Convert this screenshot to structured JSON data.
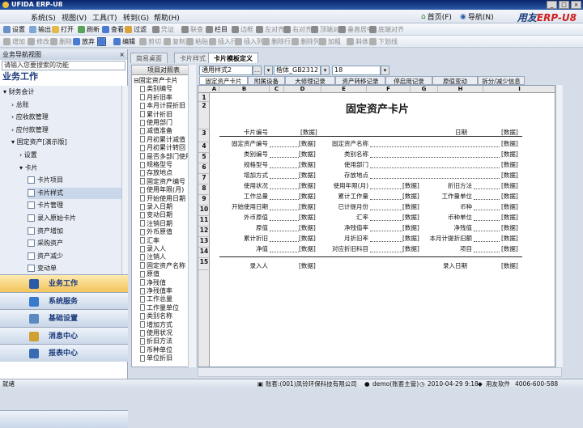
{
  "window": {
    "title": "UFIDA ERP-U8",
    "controls": [
      "_",
      "□",
      "×"
    ]
  },
  "menu": {
    "items": [
      "系统(S)",
      "视图(V)",
      "工具(T)",
      "转到(G)",
      "帮助(H)"
    ],
    "right": [
      "首页(F)",
      "导航(N)"
    ],
    "brand_a": "用友",
    "brand_b": "ERP-U8"
  },
  "toolbar1": [
    "设置",
    "输出",
    "打开",
    "刷新",
    "查看",
    "过滤",
    "凭证",
    "联查",
    "栏目",
    "边框",
    "左对齐",
    "右对齐",
    "顶端对齐",
    "垂直居中",
    "底端对齐"
  ],
  "toolbar2": [
    "增加",
    "修改",
    "删除",
    "放弃",
    "保存",
    "编辑",
    "剪切",
    "复制",
    "粘贴",
    "插入行",
    "插入列",
    "删除行",
    "删除列",
    "加粗",
    "斜体",
    "下划线"
  ],
  "sidebar": {
    "header": "业务导航视图",
    "search_placeholder": "请输入您要搜索的功能",
    "title": "业务工作",
    "tree": [
      "财务会计",
      "总账",
      "应收款管理",
      "应付款管理",
      "固定资产[演示版]",
      "设置",
      "卡片",
      "卡片项目",
      "卡片样式",
      "卡片管理",
      "录入原始卡片",
      "资产增加",
      "采购资产",
      "资产减少",
      "变动单"
    ],
    "modules": [
      "业务工作",
      "系统服务",
      "基础设置",
      "消息中心",
      "报表中心"
    ]
  },
  "tabs": [
    "简易桌面",
    "卡片样式",
    "卡片模板定义"
  ],
  "lefttree": {
    "header": "项目对照表",
    "items": [
      "固定资产卡片",
      "类别编号",
      "月折旧率",
      "本月计提折旧",
      "累计折旧",
      "使用部门",
      "减值准备",
      "月初累计减值",
      "月初累计转回",
      "是否多部门使用",
      "规格型号",
      "存放地点",
      "固定资产编号",
      "使用年限(月)",
      "开始使用日期",
      "录入日期",
      "变动日期",
      "注销日期",
      "外币原值",
      "汇率",
      "录入人",
      "注销人",
      "固定资产名称",
      "原值",
      "净残值",
      "净残值率",
      "工作总量",
      "工作量单位",
      "类别名称",
      "增加方式",
      "使用状况",
      "折旧方法",
      "币种单位",
      "单位折旧"
    ]
  },
  "format": {
    "style": "通用样式2",
    "font": "楷体_GB2312",
    "size": "18"
  },
  "subtabs": [
    "固定资产卡片",
    "附属设备",
    "大修理记录",
    "资产转移记录",
    "停启用记录",
    "原值变动",
    "拆分/减少信息"
  ],
  "grid": {
    "columns": [
      "A",
      "B",
      "C",
      "D",
      "E",
      "F",
      "G",
      "H",
      "I"
    ],
    "rows": [
      "1",
      "2",
      "3",
      "4",
      "5",
      "6",
      "7",
      "8",
      "9",
      "10",
      "11",
      "12",
      "13",
      "14",
      "15"
    ],
    "title": "固定资产卡片",
    "placeholder": "[数据]",
    "row3": {
      "a": "卡片编号",
      "b": "日期"
    },
    "pairs": [
      [
        "固定资产编号",
        "固定资产名称"
      ],
      [
        "类别编号",
        "类别名称"
      ],
      [
        "规格型号",
        "使用部门"
      ],
      [
        "增加方式",
        "存放地点"
      ]
    ],
    "triples": [
      [
        "使用状况",
        "使用年限(月)",
        "折旧方法"
      ],
      [
        "工作总量",
        "累计工作量",
        "工作量单位"
      ],
      [
        "开始使用日期",
        "已计提月份",
        "币种"
      ],
      [
        "外币原值",
        "汇率",
        "币种单位"
      ],
      [
        "原值",
        "净残值率",
        "净残值"
      ],
      [
        "累计折旧",
        "月折旧率",
        "本月计提折旧额"
      ],
      [
        "净值",
        "对应折旧科目",
        "项目"
      ]
    ],
    "row15": {
      "a": "录入人",
      "b": "录入日期"
    }
  },
  "status": {
    "left": "就绪",
    "account": "账套:(001)凤铃环保科技有限公司",
    "user": "demo(账套主管)",
    "datetime": "2010-04-29 9:18",
    "vendor": "用友软件",
    "phone": "4006-600-588"
  }
}
